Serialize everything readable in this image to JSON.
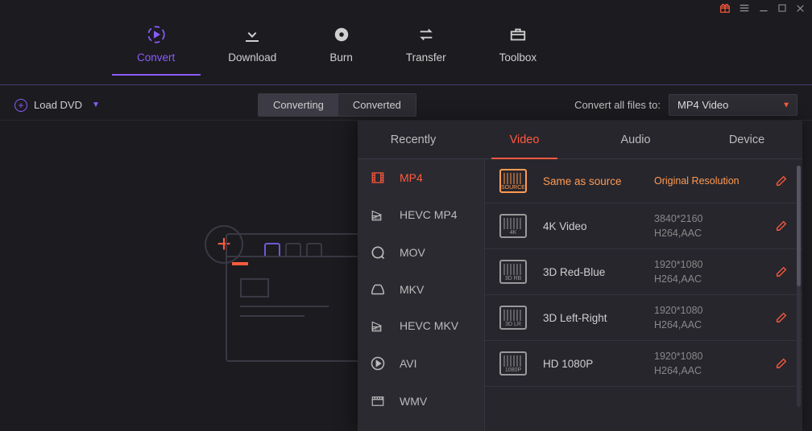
{
  "titlebar": {
    "gift_icon": "gift",
    "menu_icon": "menu",
    "min_icon": "minimize",
    "max_icon": "maximize",
    "close_icon": "close"
  },
  "topnav": {
    "items": [
      {
        "label": "Convert",
        "icon": "convert",
        "active": true
      },
      {
        "label": "Download",
        "icon": "download",
        "active": false
      },
      {
        "label": "Burn",
        "icon": "burn",
        "active": false
      },
      {
        "label": "Transfer",
        "icon": "transfer",
        "active": false
      },
      {
        "label": "Toolbox",
        "icon": "toolbox",
        "active": false
      }
    ]
  },
  "subbar": {
    "load_label": "Load DVD",
    "seg": {
      "converting": "Converting",
      "converted": "Converted",
      "active": "converting"
    },
    "convert_all_label": "Convert all files to:",
    "select_value": "MP4 Video"
  },
  "panel": {
    "tabs": [
      {
        "label": "Recently",
        "active": false
      },
      {
        "label": "Video",
        "active": true
      },
      {
        "label": "Audio",
        "active": false
      },
      {
        "label": "Device",
        "active": false
      }
    ],
    "formats": [
      {
        "label": "MP4",
        "icon": "film",
        "active": true
      },
      {
        "label": "HEVC MP4",
        "icon": "hevc",
        "active": false
      },
      {
        "label": "MOV",
        "icon": "qt",
        "active": false
      },
      {
        "label": "MKV",
        "icon": "mkv",
        "active": false
      },
      {
        "label": "HEVC MKV",
        "icon": "hevc",
        "active": false
      },
      {
        "label": "AVI",
        "icon": "play",
        "active": false
      },
      {
        "label": "WMV",
        "icon": "wmv",
        "active": false
      }
    ],
    "presets": [
      {
        "title": "Same as source",
        "res": "Original Resolution",
        "codec": "",
        "tag": "SOURCE",
        "selected": true
      },
      {
        "title": "4K Video",
        "res": "3840*2160",
        "codec": "H264,AAC",
        "tag": "4K",
        "selected": false
      },
      {
        "title": "3D Red-Blue",
        "res": "1920*1080",
        "codec": "H264,AAC",
        "tag": "3D RB",
        "selected": false
      },
      {
        "title": "3D Left-Right",
        "res": "1920*1080",
        "codec": "H264,AAC",
        "tag": "3D LR",
        "selected": false
      },
      {
        "title": "HD 1080P",
        "res": "1920*1080",
        "codec": "H264,AAC",
        "tag": "1080P",
        "selected": false
      }
    ]
  }
}
